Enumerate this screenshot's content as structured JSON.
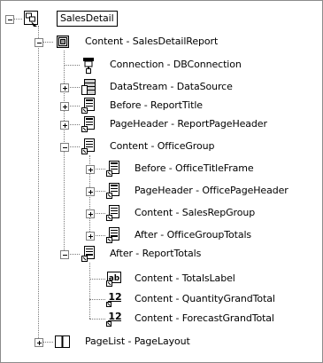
{
  "tree": {
    "root": {
      "label": "SalesDetail",
      "icon": "report-root-icon",
      "expanded": true
    },
    "nodes": [
      {
        "id": "content-salesdetailreport",
        "label": "Content - SalesDetailReport",
        "icon": "report-icon",
        "expanded": true
      },
      {
        "id": "connection",
        "label": "Connection - DBConnection",
        "icon": "connection-plug-icon"
      },
      {
        "id": "datastream",
        "label": "DataStream - DataSource",
        "icon": "database-icon",
        "expanded": false
      },
      {
        "id": "before-reporttitle",
        "label": "Before - ReportTitle",
        "icon": "frame-icon",
        "expanded": false
      },
      {
        "id": "pageheader-reportpageheader",
        "label": "PageHeader - ReportPageHeader",
        "icon": "frame-icon",
        "expanded": false
      },
      {
        "id": "content-officegroup",
        "label": "Content - OfficeGroup",
        "icon": "group-icon",
        "expanded": true
      },
      {
        "id": "before-officetitleframe",
        "label": "Before - OfficeTitleFrame",
        "icon": "frame-icon",
        "expanded": false
      },
      {
        "id": "pageheader-officepageheader",
        "label": "PageHeader - OfficePageHeader",
        "icon": "frame-icon",
        "expanded": false
      },
      {
        "id": "content-salesrepgroup",
        "label": "Content - SalesRepGroup",
        "icon": "group-icon",
        "expanded": false
      },
      {
        "id": "after-officegrouptotals",
        "label": "After - OfficeGroupTotals",
        "icon": "frame-icon",
        "expanded": false
      },
      {
        "id": "after-reporttotals",
        "label": "After - ReportTotals",
        "icon": "frame-icon",
        "expanded": true
      },
      {
        "id": "content-totalslabel",
        "label": "Content - TotalsLabel",
        "icon": "label-ab-icon"
      },
      {
        "id": "content-quantitygrandtotal",
        "label": "Content - QuantityGrandTotal",
        "icon": "numeric-data-icon"
      },
      {
        "id": "content-forecastgrandtotal",
        "label": "Content - ForecastGrandTotal",
        "icon": "numeric-data-icon"
      },
      {
        "id": "pagelist-pagelayout",
        "label": "PageList - PageLayout",
        "icon": "pages-icon",
        "expanded": false
      }
    ],
    "icon_text": {
      "label_ab": "ab",
      "numeric": "12"
    }
  }
}
